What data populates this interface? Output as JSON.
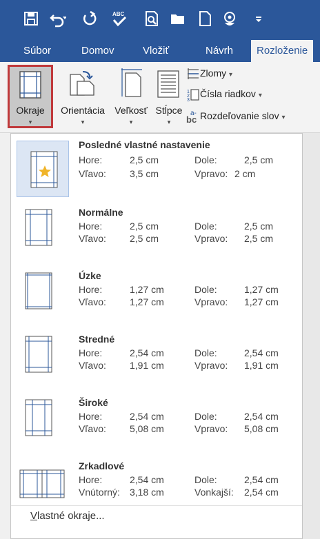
{
  "qat": {
    "icons": [
      "save-icon",
      "undo-icon",
      "redo-icon",
      "spelling-icon",
      "print-preview-icon",
      "open-icon",
      "new-icon",
      "touch-mode-icon",
      "customize-dropdown-icon"
    ]
  },
  "tabs": [
    {
      "label": "Súbor"
    },
    {
      "label": "Domov"
    },
    {
      "label": "Vložiť"
    },
    {
      "label": "Návrh"
    },
    {
      "label": "Rozloženie"
    }
  ],
  "ribbon": {
    "okraje": "Okraje",
    "orientacia": "Orientácia",
    "velkost": "Veľkosť",
    "stlpce": "Stĺpce",
    "zlomy": "Zlomy",
    "cisla": "Čísla riadkov",
    "rozdelovanie": "Rozdeľovanie slov",
    "hyphen_glyph": "bc",
    "hyphen_sup": "a-",
    "dropdown_glyph": "▾"
  },
  "menu": {
    "options": [
      {
        "name": "Posledné vlastné nastavenie",
        "l1": "Hore:",
        "v1": "2,5 cm",
        "l2": "Dole:",
        "v2": "2,5 cm",
        "l3": "Vľavo:",
        "v3": "3,5 cm",
        "l4": "Vpravo:",
        "v4": "2 cm"
      },
      {
        "name": "Normálne",
        "l1": "Hore:",
        "v1": "2,5 cm",
        "l2": "Dole:",
        "v2": "2,5 cm",
        "l3": "Vľavo:",
        "v3": "2,5 cm",
        "l4": "Vpravo:",
        "v4": "2,5 cm"
      },
      {
        "name": "Úzke",
        "l1": "Hore:",
        "v1": "1,27 cm",
        "l2": "Dole:",
        "v2": "1,27 cm",
        "l3": "Vľavo:",
        "v3": "1,27 cm",
        "l4": "Vpravo:",
        "v4": "1,27 cm"
      },
      {
        "name": "Stredné",
        "l1": "Hore:",
        "v1": "2,54 cm",
        "l2": "Dole:",
        "v2": "2,54 cm",
        "l3": "Vľavo:",
        "v3": "1,91 cm",
        "l4": "Vpravo:",
        "v4": "1,91 cm"
      },
      {
        "name": "Široké",
        "l1": "Hore:",
        "v1": "2,54 cm",
        "l2": "Dole:",
        "v2": "2,54 cm",
        "l3": "Vľavo:",
        "v3": "5,08 cm",
        "l4": "Vpravo:",
        "v4": "5,08 cm"
      },
      {
        "name": "Zrkadlové",
        "l1": "Hore:",
        "v1": "2,54 cm",
        "l2": "Dole:",
        "v2": "2,54 cm",
        "l3": "Vnútorný:",
        "v3": "3,18 cm",
        "l4": "Vonkajší:",
        "v4": "2,54 cm"
      }
    ],
    "footer_first": "V",
    "footer_rest": "lastné okraje..."
  },
  "colors": {
    "accent": "#2b579a",
    "selected_border": "#c0393b",
    "highlight": "#dce6f4",
    "star": "#f0b429"
  }
}
